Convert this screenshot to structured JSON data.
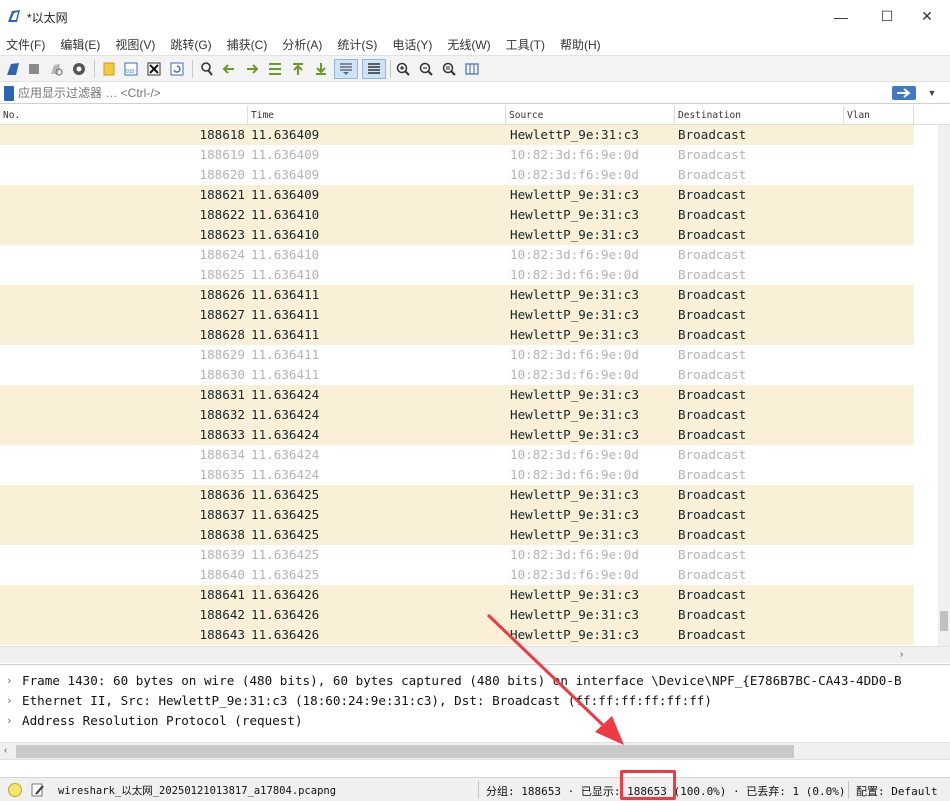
{
  "window": {
    "title": "*以太网",
    "minimize": "—",
    "maximize": "☐",
    "close": "✕"
  },
  "menu": [
    "文件(F)",
    "编辑(E)",
    "视图(V)",
    "跳转(G)",
    "捕获(C)",
    "分析(A)",
    "统计(S)",
    "电话(Y)",
    "无线(W)",
    "工具(T)",
    "帮助(H)"
  ],
  "toolbar": {
    "icons": [
      "shark-fin-start-icon",
      "stop-icon",
      "restart-icon",
      "capture-options-icon",
      "open-file-icon",
      "save-file-icon",
      "close-file-icon",
      "reload-icon",
      "find-packet-icon",
      "go-back-icon",
      "go-forward-icon",
      "go-to-packet-icon",
      "go-first-icon",
      "go-last-icon",
      "autoscroll-icon",
      "colorize-icon",
      "zoom-in-icon",
      "zoom-out-icon",
      "zoom-normal-icon",
      "resize-columns-icon"
    ]
  },
  "filter": {
    "placeholder": "应用显示过滤器 … <Ctrl-/>"
  },
  "packet_list": {
    "headers": [
      "No.",
      "Time",
      "Source",
      "Destination",
      "Vlan"
    ],
    "rows": [
      {
        "no": "188618",
        "time": "11.636409",
        "source": "HewlettP_9e:31:c3",
        "destination": "Broadcast",
        "style": "arp"
      },
      {
        "no": "188619",
        "time": "11.636409",
        "source": "10:82:3d:f6:9e:0d",
        "destination": "Broadcast",
        "style": "other"
      },
      {
        "no": "188620",
        "time": "11.636409",
        "source": "10:82:3d:f6:9e:0d",
        "destination": "Broadcast",
        "style": "other"
      },
      {
        "no": "188621",
        "time": "11.636409",
        "source": "HewlettP_9e:31:c3",
        "destination": "Broadcast",
        "style": "arp"
      },
      {
        "no": "188622",
        "time": "11.636410",
        "source": "HewlettP_9e:31:c3",
        "destination": "Broadcast",
        "style": "arp"
      },
      {
        "no": "188623",
        "time": "11.636410",
        "source": "HewlettP_9e:31:c3",
        "destination": "Broadcast",
        "style": "arp"
      },
      {
        "no": "188624",
        "time": "11.636410",
        "source": "10:82:3d:f6:9e:0d",
        "destination": "Broadcast",
        "style": "other"
      },
      {
        "no": "188625",
        "time": "11.636410",
        "source": "10:82:3d:f6:9e:0d",
        "destination": "Broadcast",
        "style": "other"
      },
      {
        "no": "188626",
        "time": "11.636411",
        "source": "HewlettP_9e:31:c3",
        "destination": "Broadcast",
        "style": "arp"
      },
      {
        "no": "188627",
        "time": "11.636411",
        "source": "HewlettP_9e:31:c3",
        "destination": "Broadcast",
        "style": "arp"
      },
      {
        "no": "188628",
        "time": "11.636411",
        "source": "HewlettP_9e:31:c3",
        "destination": "Broadcast",
        "style": "arp"
      },
      {
        "no": "188629",
        "time": "11.636411",
        "source": "10:82:3d:f6:9e:0d",
        "destination": "Broadcast",
        "style": "other"
      },
      {
        "no": "188630",
        "time": "11.636411",
        "source": "10:82:3d:f6:9e:0d",
        "destination": "Broadcast",
        "style": "other"
      },
      {
        "no": "188631",
        "time": "11.636424",
        "source": "HewlettP_9e:31:c3",
        "destination": "Broadcast",
        "style": "arp"
      },
      {
        "no": "188632",
        "time": "11.636424",
        "source": "HewlettP_9e:31:c3",
        "destination": "Broadcast",
        "style": "arp"
      },
      {
        "no": "188633",
        "time": "11.636424",
        "source": "HewlettP_9e:31:c3",
        "destination": "Broadcast",
        "style": "arp"
      },
      {
        "no": "188634",
        "time": "11.636424",
        "source": "10:82:3d:f6:9e:0d",
        "destination": "Broadcast",
        "style": "other"
      },
      {
        "no": "188635",
        "time": "11.636424",
        "source": "10:82:3d:f6:9e:0d",
        "destination": "Broadcast",
        "style": "other"
      },
      {
        "no": "188636",
        "time": "11.636425",
        "source": "HewlettP_9e:31:c3",
        "destination": "Broadcast",
        "style": "arp"
      },
      {
        "no": "188637",
        "time": "11.636425",
        "source": "HewlettP_9e:31:c3",
        "destination": "Broadcast",
        "style": "arp"
      },
      {
        "no": "188638",
        "time": "11.636425",
        "source": "HewlettP_9e:31:c3",
        "destination": "Broadcast",
        "style": "arp"
      },
      {
        "no": "188639",
        "time": "11.636425",
        "source": "10:82:3d:f6:9e:0d",
        "destination": "Broadcast",
        "style": "other"
      },
      {
        "no": "188640",
        "time": "11.636425",
        "source": "10:82:3d:f6:9e:0d",
        "destination": "Broadcast",
        "style": "other"
      },
      {
        "no": "188641",
        "time": "11.636426",
        "source": "HewlettP_9e:31:c3",
        "destination": "Broadcast",
        "style": "arp"
      },
      {
        "no": "188642",
        "time": "11.636426",
        "source": "HewlettP_9e:31:c3",
        "destination": "Broadcast",
        "style": "arp"
      },
      {
        "no": "188643",
        "time": "11.636426",
        "source": "HewlettP_9e:31:c3",
        "destination": "Broadcast",
        "style": "arp"
      }
    ]
  },
  "details": [
    {
      "text": "Frame 1430: 60 bytes on wire (480 bits), 60 bytes captured (480 bits) on interface \\Device\\NPF_{E786B7BC-CA43-4DD0-B"
    },
    {
      "text": "Ethernet II, Src: HewlettP_9e:31:c3 (18:60:24:9e:31:c3), Dst: Broadcast (ff:ff:ff:ff:ff:ff)"
    },
    {
      "text": "Address Resolution Protocol (request)"
    }
  ],
  "statusbar": {
    "file": "wireshark_以太网_20250121013817_a17804.pcapng",
    "stats": "分组: 188653 · 已显示: 188653 (100.0%) · 已丢弃: 1 (0.0%)",
    "profile": "配置: Default"
  },
  "colors": {
    "arp_row": "#faf0d7",
    "dim_text": "#b3b3b3",
    "annotation": "#ee3a43"
  }
}
